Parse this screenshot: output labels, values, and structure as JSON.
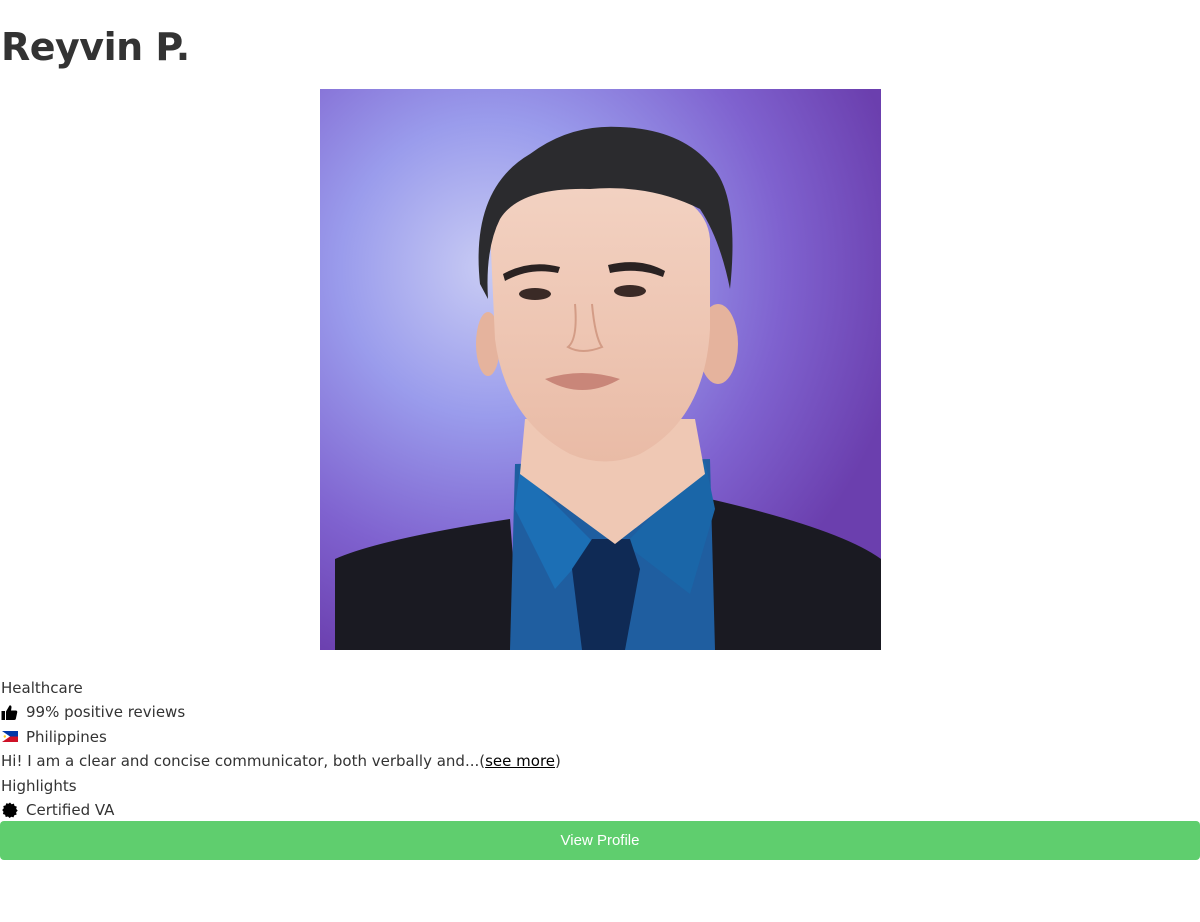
{
  "profile": {
    "name": "Reyvin P.",
    "photo_alt": "Reyvin P.",
    "category": "Healthcare",
    "reviews": "99% positive reviews",
    "country": "Philippines",
    "bio": "Hi! I am a clear and concise communicator, both verbally and...",
    "see_more_open": "(",
    "see_more_label": "see more",
    "see_more_close": ")",
    "highlights_label": "Highlights",
    "highlight_item": "Certified VA",
    "view_profile_label": "View Profile"
  },
  "icons": {
    "reviews": "thumbs-up-icon",
    "country": "philippines-flag-icon",
    "highlight": "certificate-badge-icon"
  },
  "colors": {
    "button_bg": "#5fce6e",
    "text": "#333333",
    "photo_bg": "#8a80e0"
  }
}
